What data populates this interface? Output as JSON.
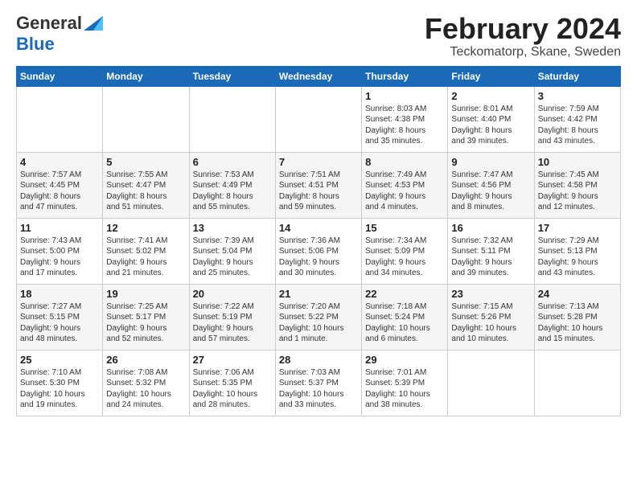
{
  "header": {
    "logo_general": "General",
    "logo_blue": "Blue",
    "month_title": "February 2024",
    "location": "Teckomatorp, Skane, Sweden"
  },
  "weekdays": [
    "Sunday",
    "Monday",
    "Tuesday",
    "Wednesday",
    "Thursday",
    "Friday",
    "Saturday"
  ],
  "weeks": [
    [
      {
        "day": "",
        "info": ""
      },
      {
        "day": "",
        "info": ""
      },
      {
        "day": "",
        "info": ""
      },
      {
        "day": "",
        "info": ""
      },
      {
        "day": "1",
        "info": "Sunrise: 8:03 AM\nSunset: 4:38 PM\nDaylight: 8 hours\nand 35 minutes."
      },
      {
        "day": "2",
        "info": "Sunrise: 8:01 AM\nSunset: 4:40 PM\nDaylight: 8 hours\nand 39 minutes."
      },
      {
        "day": "3",
        "info": "Sunrise: 7:59 AM\nSunset: 4:42 PM\nDaylight: 8 hours\nand 43 minutes."
      }
    ],
    [
      {
        "day": "4",
        "info": "Sunrise: 7:57 AM\nSunset: 4:45 PM\nDaylight: 8 hours\nand 47 minutes."
      },
      {
        "day": "5",
        "info": "Sunrise: 7:55 AM\nSunset: 4:47 PM\nDaylight: 8 hours\nand 51 minutes."
      },
      {
        "day": "6",
        "info": "Sunrise: 7:53 AM\nSunset: 4:49 PM\nDaylight: 8 hours\nand 55 minutes."
      },
      {
        "day": "7",
        "info": "Sunrise: 7:51 AM\nSunset: 4:51 PM\nDaylight: 8 hours\nand 59 minutes."
      },
      {
        "day": "8",
        "info": "Sunrise: 7:49 AM\nSunset: 4:53 PM\nDaylight: 9 hours\nand 4 minutes."
      },
      {
        "day": "9",
        "info": "Sunrise: 7:47 AM\nSunset: 4:56 PM\nDaylight: 9 hours\nand 8 minutes."
      },
      {
        "day": "10",
        "info": "Sunrise: 7:45 AM\nSunset: 4:58 PM\nDaylight: 9 hours\nand 12 minutes."
      }
    ],
    [
      {
        "day": "11",
        "info": "Sunrise: 7:43 AM\nSunset: 5:00 PM\nDaylight: 9 hours\nand 17 minutes."
      },
      {
        "day": "12",
        "info": "Sunrise: 7:41 AM\nSunset: 5:02 PM\nDaylight: 9 hours\nand 21 minutes."
      },
      {
        "day": "13",
        "info": "Sunrise: 7:39 AM\nSunset: 5:04 PM\nDaylight: 9 hours\nand 25 minutes."
      },
      {
        "day": "14",
        "info": "Sunrise: 7:36 AM\nSunset: 5:06 PM\nDaylight: 9 hours\nand 30 minutes."
      },
      {
        "day": "15",
        "info": "Sunrise: 7:34 AM\nSunset: 5:09 PM\nDaylight: 9 hours\nand 34 minutes."
      },
      {
        "day": "16",
        "info": "Sunrise: 7:32 AM\nSunset: 5:11 PM\nDaylight: 9 hours\nand 39 minutes."
      },
      {
        "day": "17",
        "info": "Sunrise: 7:29 AM\nSunset: 5:13 PM\nDaylight: 9 hours\nand 43 minutes."
      }
    ],
    [
      {
        "day": "18",
        "info": "Sunrise: 7:27 AM\nSunset: 5:15 PM\nDaylight: 9 hours\nand 48 minutes."
      },
      {
        "day": "19",
        "info": "Sunrise: 7:25 AM\nSunset: 5:17 PM\nDaylight: 9 hours\nand 52 minutes."
      },
      {
        "day": "20",
        "info": "Sunrise: 7:22 AM\nSunset: 5:19 PM\nDaylight: 9 hours\nand 57 minutes."
      },
      {
        "day": "21",
        "info": "Sunrise: 7:20 AM\nSunset: 5:22 PM\nDaylight: 10 hours\nand 1 minute."
      },
      {
        "day": "22",
        "info": "Sunrise: 7:18 AM\nSunset: 5:24 PM\nDaylight: 10 hours\nand 6 minutes."
      },
      {
        "day": "23",
        "info": "Sunrise: 7:15 AM\nSunset: 5:26 PM\nDaylight: 10 hours\nand 10 minutes."
      },
      {
        "day": "24",
        "info": "Sunrise: 7:13 AM\nSunset: 5:28 PM\nDaylight: 10 hours\nand 15 minutes."
      }
    ],
    [
      {
        "day": "25",
        "info": "Sunrise: 7:10 AM\nSunset: 5:30 PM\nDaylight: 10 hours\nand 19 minutes."
      },
      {
        "day": "26",
        "info": "Sunrise: 7:08 AM\nSunset: 5:32 PM\nDaylight: 10 hours\nand 24 minutes."
      },
      {
        "day": "27",
        "info": "Sunrise: 7:06 AM\nSunset: 5:35 PM\nDaylight: 10 hours\nand 28 minutes."
      },
      {
        "day": "28",
        "info": "Sunrise: 7:03 AM\nSunset: 5:37 PM\nDaylight: 10 hours\nand 33 minutes."
      },
      {
        "day": "29",
        "info": "Sunrise: 7:01 AM\nSunset: 5:39 PM\nDaylight: 10 hours\nand 38 minutes."
      },
      {
        "day": "",
        "info": ""
      },
      {
        "day": "",
        "info": ""
      }
    ]
  ]
}
